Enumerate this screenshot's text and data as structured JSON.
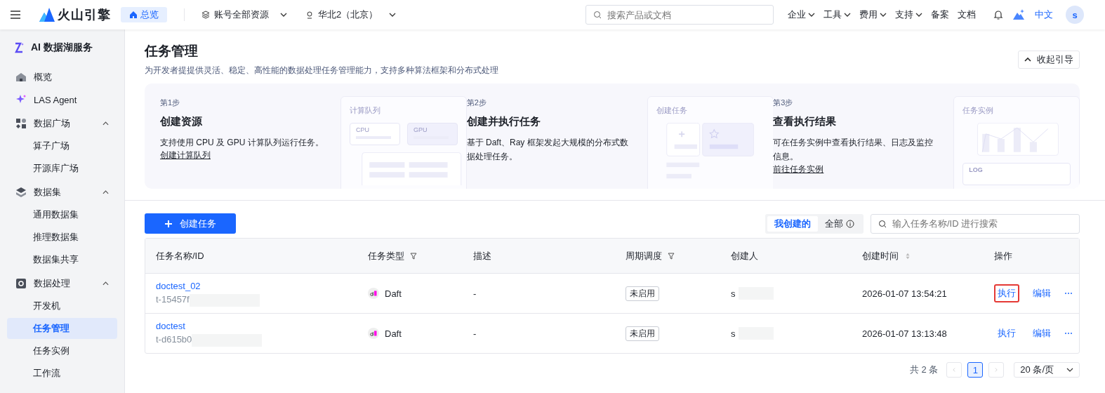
{
  "topbar": {
    "brand": "火山引擎",
    "home_tab": "总览",
    "account_scope": "账号全部资源",
    "region": "华北2（北京）",
    "search": {
      "placeholder": "搜索产品或文档"
    },
    "menus": [
      {
        "label": "企业",
        "dropdown": true
      },
      {
        "label": "工具",
        "dropdown": true
      },
      {
        "label": "费用",
        "dropdown": true
      },
      {
        "label": "支持",
        "dropdown": true
      },
      {
        "label": "备案",
        "dropdown": false
      },
      {
        "label": "文档",
        "dropdown": false
      }
    ],
    "language": "中文",
    "avatar": "s"
  },
  "sidebar": {
    "title": "AI 数据湖服务",
    "items": [
      {
        "label": "概览",
        "selected": false
      },
      {
        "label": "LAS Agent",
        "selected": false
      },
      {
        "label": "数据广场",
        "expanded": true,
        "children": [
          {
            "label": "算子广场",
            "selected": false
          },
          {
            "label": "开源库广场",
            "selected": false
          }
        ]
      },
      {
        "label": "数据集",
        "expanded": true,
        "children": [
          {
            "label": "通用数据集",
            "selected": false
          },
          {
            "label": "推理数据集",
            "selected": false
          },
          {
            "label": "数据集共享",
            "selected": false
          }
        ]
      },
      {
        "label": "数据处理",
        "expanded": true,
        "children": [
          {
            "label": "开发机",
            "selected": false
          },
          {
            "label": "任务管理",
            "selected": true
          },
          {
            "label": "任务实例",
            "selected": false
          },
          {
            "label": "工作流",
            "selected": false
          }
        ]
      }
    ]
  },
  "page": {
    "title": "任务管理",
    "description": "为开发者提提供灵活、稳定、高性能的数据处理任务管理能力，支持多种算法框架和分布式处理",
    "collapse_guide": "收起引导"
  },
  "guide": [
    {
      "step": "第1步",
      "title": "创建资源",
      "text": "支持使用 CPU 及 GPU 计算队列运行任务。",
      "link": "创建计算队列",
      "illustration": {
        "kind": "queue",
        "title": "计算队列",
        "labels": [
          "CPU",
          "GPU"
        ]
      }
    },
    {
      "step": "第2步",
      "title": "创建并执行任务",
      "text": "基于 Daft、Ray 框架发起大规模的分布式数据处理任务。",
      "illustration": {
        "kind": "task",
        "title": "创建任务"
      }
    },
    {
      "step": "第3步",
      "title": "查看执行结果",
      "text": "可在任务实例中查看执行结果、日志及监控信息。",
      "link": "前往任务实例",
      "illustration": {
        "kind": "chart",
        "title": "任务实例",
        "labels": [
          "LOG"
        ]
      }
    }
  ],
  "create_button": "创建任务",
  "scope_tabs": [
    {
      "label": "我创建的",
      "selected": true,
      "info": false
    },
    {
      "label": "全部",
      "selected": false,
      "info": true
    }
  ],
  "table_search": {
    "placeholder": "输入任务名称/ID 进行搜索"
  },
  "table": {
    "columns": [
      {
        "label": "任务名称/ID",
        "kind": "plain"
      },
      {
        "label": "任务类型",
        "kind": "filter"
      },
      {
        "label": "描述",
        "kind": "plain"
      },
      {
        "label": "周期调度",
        "kind": "filter"
      },
      {
        "label": "创建人",
        "kind": "plain"
      },
      {
        "label": "创建时间",
        "kind": "sort"
      },
      {
        "label": "操作",
        "kind": "plain"
      }
    ],
    "rows": [
      {
        "name": "doctest_02",
        "id": "t-15457f",
        "type": "Daft",
        "description": "-",
        "schedule": "未启用",
        "creator": "s",
        "created": "2026-01-07 13:54:21",
        "actions": [
          {
            "label": "执行",
            "highlighted": true
          },
          {
            "label": "编辑",
            "highlighted": false
          }
        ]
      },
      {
        "name": "doctest",
        "id": "t-d615b0",
        "type": "Daft",
        "description": "-",
        "schedule": "未启用",
        "creator": "s",
        "created": "2026-01-07 13:13:48",
        "actions": [
          {
            "label": "执行",
            "highlighted": false
          },
          {
            "label": "编辑",
            "highlighted": false
          }
        ]
      }
    ]
  },
  "pagination": {
    "total": "共 2 条",
    "pages": [
      {
        "label": "1",
        "selected": true
      }
    ],
    "page_size": "20 条/页"
  }
}
